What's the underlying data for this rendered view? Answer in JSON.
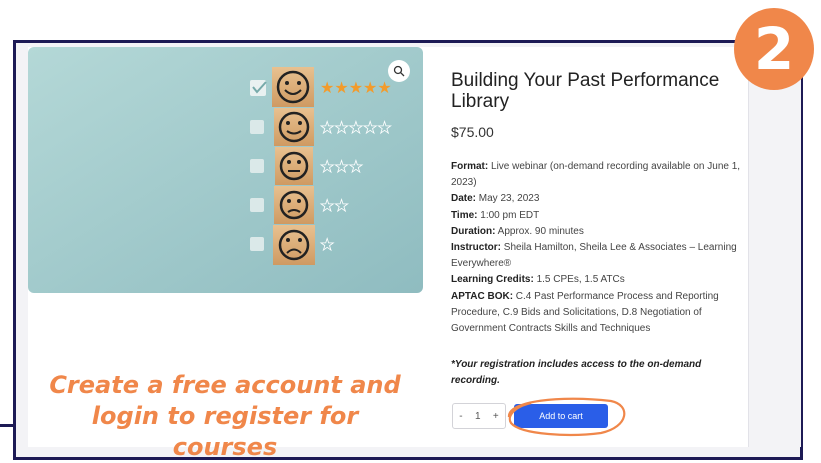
{
  "product": {
    "title": "Building Your Past Performance Library",
    "price": "$75.00",
    "details": [
      {
        "label": "Format:",
        "value": " Live webinar (on-demand recording available on June 1, 2023)"
      },
      {
        "label": "Date:",
        "value": " May 23, 2023"
      },
      {
        "label": "Time:",
        "value": " 1:00 pm EDT"
      },
      {
        "label": "Duration:",
        "value": " Approx. 90 minutes"
      },
      {
        "label": "Instructor:",
        "value": " Sheila Hamilton, Sheila Lee & Associates – Learning Everywhere®"
      },
      {
        "label": "Learning Credits:",
        "value": " 1.5 CPEs, 1.5 ATCs"
      },
      {
        "label": "APTAC BOK:",
        "value": " C.4 Past Performance Process and Reporting Procedure, C.9 Bids and Solicitations, D.8 Negotiation of Government Contracts Skills and Techniques"
      }
    ],
    "note": "*Your registration includes access to the on-demand recording.",
    "quantity": "1",
    "qty_minus": "-",
    "qty_plus": "+",
    "add_to_cart": "Add to cart"
  },
  "image": {
    "icons": [
      "search-icon",
      "checkbox-icon",
      "smiley-icon",
      "star-icon"
    ],
    "rating_rows": [
      {
        "face": "happy",
        "stars_filled": 5,
        "checked": true
      },
      {
        "face": "slight-smile",
        "stars_filled": 0,
        "stars_total": 5,
        "checked": false
      },
      {
        "face": "neutral",
        "stars_filled": 0,
        "stars_total": 3,
        "checked": false
      },
      {
        "face": "frown",
        "stars_filled": 0,
        "stars_total": 2,
        "checked": false
      },
      {
        "face": "sad",
        "stars_filled": 0,
        "stars_total": 1,
        "checked": false
      }
    ]
  },
  "overlay": {
    "promo_line1": "Create a free account and",
    "promo_line2": "login to register for courses",
    "badge_number": "2"
  },
  "colors": {
    "accent_orange": "#f0874a",
    "frame_navy": "#1d1a55",
    "button_blue": "#2a5ee8",
    "image_bg": "#a9cfd0"
  }
}
